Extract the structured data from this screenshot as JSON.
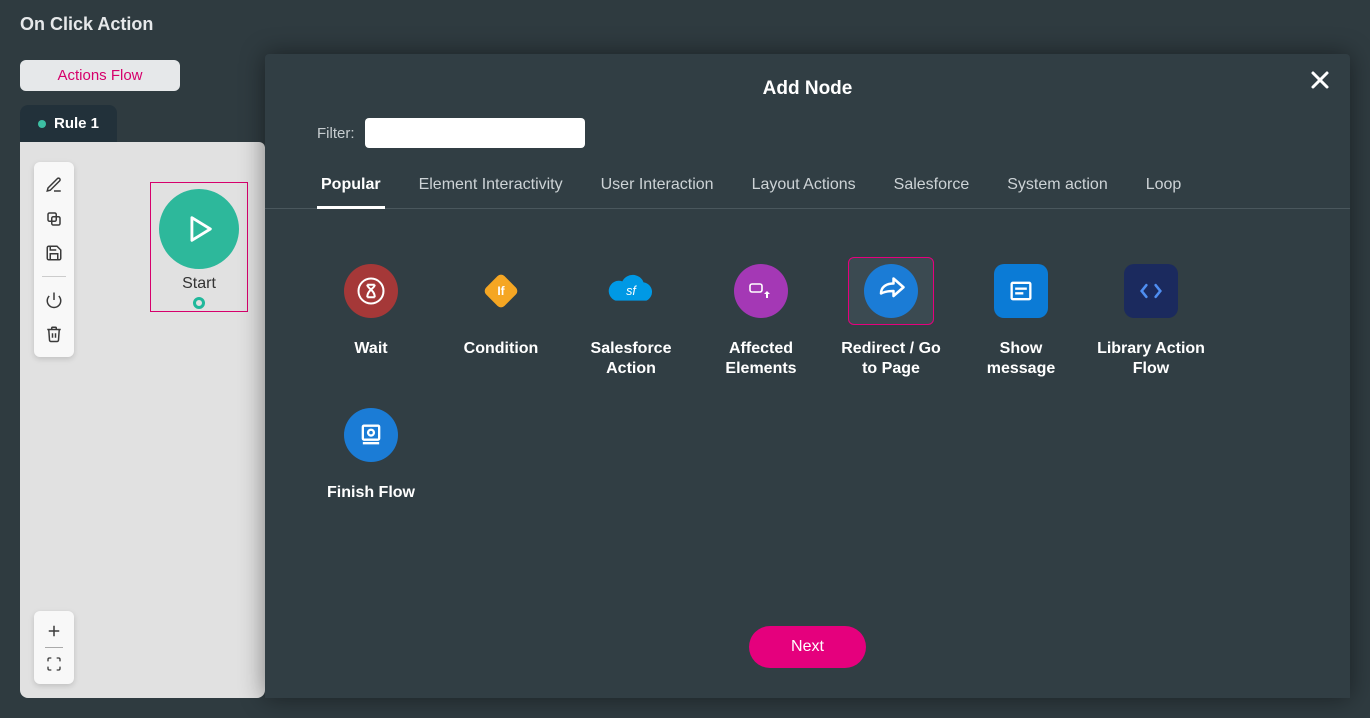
{
  "header": {
    "title": "On Click Action"
  },
  "left": {
    "actions_flow_label": "Actions Flow",
    "rule_tab": "Rule 1",
    "start_label": "Start"
  },
  "modal": {
    "title": "Add Node",
    "filter_label": "Filter:",
    "filter_value": "",
    "tabs": [
      "Popular",
      "Element Interactivity",
      "User Interaction",
      "Layout Actions",
      "Salesforce",
      "System action",
      "Loop"
    ],
    "active_tab": 0,
    "selected_node": 4,
    "nodes": [
      {
        "label": "Wait"
      },
      {
        "label": "Condition"
      },
      {
        "label": "Salesforce Action"
      },
      {
        "label": "Affected Elements"
      },
      {
        "label": "Redirect / Go to Page"
      },
      {
        "label": "Show message"
      },
      {
        "label": "Library Action Flow"
      },
      {
        "label": "Finish Flow"
      }
    ],
    "next_label": "Next"
  }
}
